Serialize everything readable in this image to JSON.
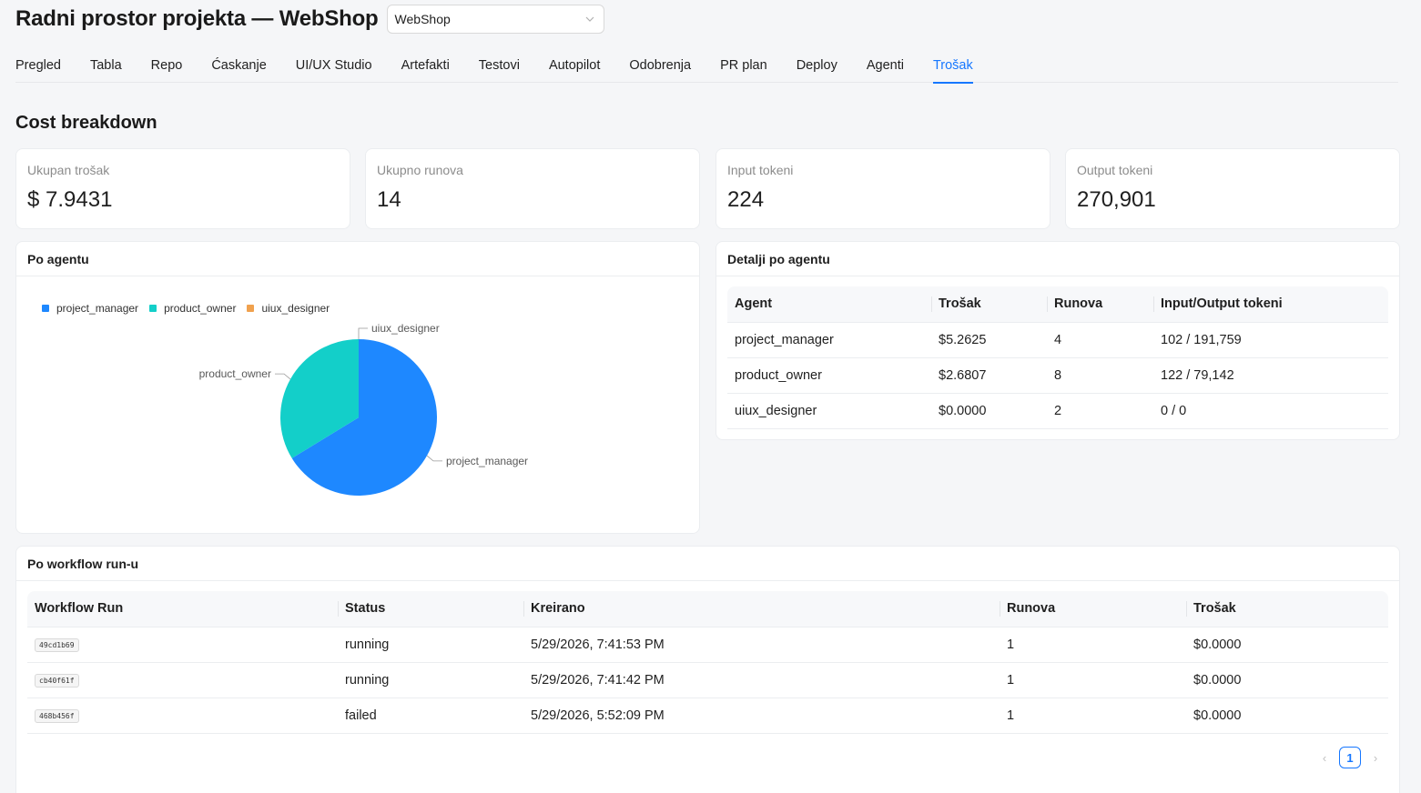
{
  "header": {
    "title": "Radni prostor projekta — WebShop",
    "project_select": "WebShop"
  },
  "tabs": [
    {
      "label": "Pregled"
    },
    {
      "label": "Tabla"
    },
    {
      "label": "Repo"
    },
    {
      "label": "Ćaskanje"
    },
    {
      "label": "UI/UX Studio"
    },
    {
      "label": "Artefakti"
    },
    {
      "label": "Testovi"
    },
    {
      "label": "Autopilot"
    },
    {
      "label": "Odobrenja"
    },
    {
      "label": "PR plan"
    },
    {
      "label": "Deploy"
    },
    {
      "label": "Agenti"
    },
    {
      "label": "Trošak",
      "active": true
    }
  ],
  "section_title": "Cost breakdown",
  "stats": [
    {
      "label": "Ukupan trošak",
      "value": "$ 7.9431"
    },
    {
      "label": "Ukupno runova",
      "value": "14"
    },
    {
      "label": "Input tokeni",
      "value": "224"
    },
    {
      "label": "Output tokeni",
      "value": "270,901"
    }
  ],
  "by_agent": {
    "title": "Po agentu",
    "chart_data": {
      "type": "pie",
      "labels": [
        "project_manager",
        "product_owner",
        "uiux_designer"
      ],
      "values": [
        5.2625,
        2.6807,
        0.0
      ],
      "colors": [
        "#1e88ff",
        "#13cfc9",
        "#f0a14e"
      ],
      "legend_position": "top-left"
    }
  },
  "agent_details": {
    "title": "Detalji po agentu",
    "columns": [
      "Agent",
      "Trošak",
      "Runova",
      "Input/Output tokeni"
    ],
    "rows": [
      [
        "project_manager",
        "$5.2625",
        "4",
        "102 / 191,759"
      ],
      [
        "product_owner",
        "$2.6807",
        "8",
        "122 / 79,142"
      ],
      [
        "uiux_designer",
        "$0.0000",
        "2",
        "0 / 0"
      ]
    ]
  },
  "by_run": {
    "title": "Po workflow run-u",
    "columns": [
      "Workflow Run",
      "Status",
      "Kreirano",
      "Runova",
      "Trošak"
    ],
    "rows": [
      [
        "49cd1b69",
        "running",
        "5/29/2026, 7:41:53 PM",
        "1",
        "$0.0000"
      ],
      [
        "cb40f61f",
        "running",
        "5/29/2026, 7:41:42 PM",
        "1",
        "$0.0000"
      ],
      [
        "468b456f",
        "failed",
        "5/29/2026, 5:52:09 PM",
        "1",
        "$0.0000"
      ]
    ],
    "pagination": {
      "current": "1",
      "prev_icon": "chevron-left-icon",
      "next_icon": "chevron-right-icon"
    }
  },
  "colors": {
    "accent": "#1677ff",
    "background": "#f5f6f8"
  }
}
